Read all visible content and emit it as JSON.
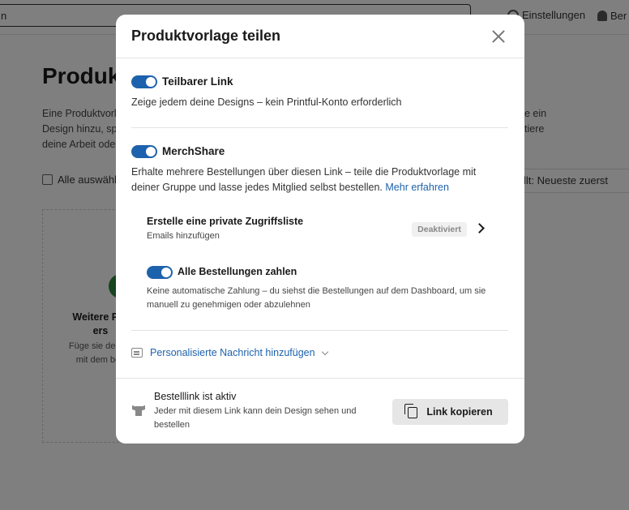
{
  "background": {
    "search_value": "n",
    "settings_label": "Einstellungen",
    "bell_label": "Ber",
    "page_title": "Produkt",
    "description_left": "Eine Produktvorl\nDesign hinzu, sp\ndeine Arbeit ode",
    "description_right": "e ein\ntiere",
    "select_all_label": "Alle auswähl",
    "sort_label": "llt: Neueste zuerst",
    "card_title": "Weitere Pro ers",
    "card_text": "Füge sie dei um mit dem beg"
  },
  "modal": {
    "title": "Produktvorlage teilen",
    "shareable_link": {
      "title": "Teilbarer Link",
      "text": "Zeige jedem deine Designs – kein Printful-Konto erforderlich",
      "enabled": true
    },
    "merchshare": {
      "title": "MerchShare",
      "text": "Erhalte mehrere Bestellungen über diesen Link – teile die Produktvorlage mit deiner Gruppe und lasse jedes Mitglied selbst bestellen.",
      "more_link": "Mehr erfahren",
      "enabled": true
    },
    "access_list": {
      "title": "Erstelle eine private Zugriffsliste",
      "subtitle": "Emails hinzufügen",
      "status_badge": "Deaktiviert"
    },
    "pay_all": {
      "title": "Alle Bestellungen zahlen",
      "text": "Keine automatische Zahlung – du siehst die Bestellungen auf dem Dashboard, um sie manuell zu genehmigen oder abzulehnen",
      "enabled": true
    },
    "personal_message_label": "Personalisierte Nachricht hinzufügen",
    "footer": {
      "title": "Bestelllink ist aktiv",
      "text": "Jeder mit diesem Link kann dein Design sehen und bestellen",
      "copy_button": "Link kopieren"
    }
  },
  "colors": {
    "accent": "#1d62ad",
    "overlay": "rgba(0,0,0,0.5)"
  }
}
